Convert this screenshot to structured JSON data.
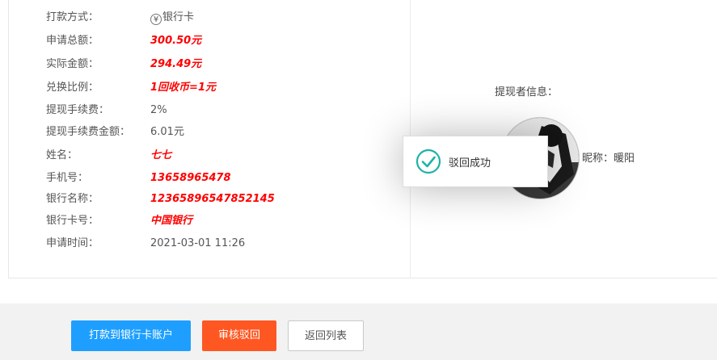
{
  "details": [
    {
      "label": "打款方式：",
      "value": "银行卡",
      "icon": "yen-circle-icon",
      "highlight": false
    },
    {
      "label": "申请总额：",
      "value": "300.50元",
      "highlight": true
    },
    {
      "label": "实际金额：",
      "value": "294.49元",
      "highlight": true
    },
    {
      "label": "兑换比例：",
      "value": "1回收币=1元",
      "highlight": true
    },
    {
      "label": "提现手续费：",
      "value": "2%",
      "highlight": false
    },
    {
      "label": "提现手续费金额：",
      "value": "6.01元",
      "highlight": false
    },
    {
      "label": "姓名：",
      "value": "七七",
      "highlight": true
    },
    {
      "label": "手机号：",
      "value": "13658965478",
      "highlight": true
    },
    {
      "label": "银行名称：",
      "value": "12365896547852145",
      "highlight": true
    },
    {
      "label": "银行卡号：",
      "value": "中国银行",
      "highlight": true
    },
    {
      "label": "申请时间：",
      "value": "2021-03-01 11:26",
      "highlight": false
    }
  ],
  "withdrawer": {
    "title": "提现者信息：",
    "nickname_label": "昵称：",
    "nickname": "暖阳"
  },
  "toast": {
    "message": "驳回成功",
    "icon": "check-circle-icon",
    "color": "#20b2aa"
  },
  "actions": {
    "transfer_label": "打款到银行卡账户",
    "reject_label": "审核驳回",
    "back_label": "返回列表"
  },
  "colors": {
    "highlight": "#ff0000",
    "primary": "#1e9fff",
    "danger": "#ff5722"
  }
}
